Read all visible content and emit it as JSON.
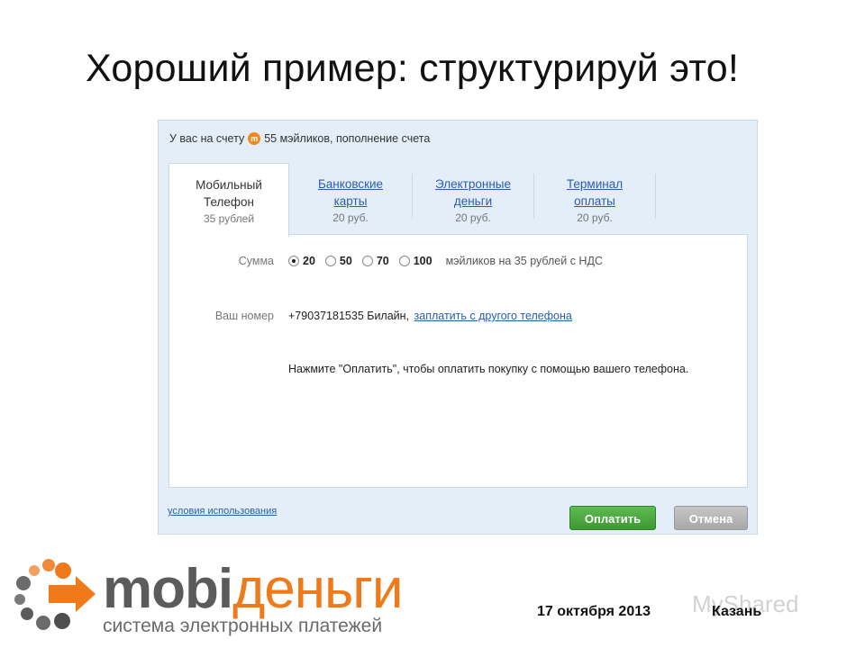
{
  "slide": {
    "title": "Хороший пример: структурируй это!",
    "date": "17 октября 2013",
    "city": "Казань",
    "watermark": "MyShared"
  },
  "widget": {
    "balance_prefix": "У вас на счету",
    "balance_text": "55 мэйликов, пополнение счета",
    "tabs": [
      {
        "label_line1": "Мобильный",
        "label_line2": "Телефон",
        "price": "35 рублей",
        "active": true
      },
      {
        "label_line1": "Банковские",
        "label_line2": "карты",
        "price": "20 руб.",
        "active": false
      },
      {
        "label_line1": "Электронные",
        "label_line2": "деньги",
        "price": "20 руб.",
        "active": false
      },
      {
        "label_line1": "Терминал",
        "label_line2": "оплаты",
        "price": "20 руб.",
        "active": false
      }
    ],
    "sum_label": "Сумма",
    "amounts": [
      "20",
      "50",
      "70",
      "100"
    ],
    "selected_amount": "20",
    "sum_note": "мэйликов на 35 рублей с НДС",
    "phone_label": "Ваш номер",
    "phone_value": "+79037181535 Билайн,",
    "phone_link": "заплатить с другого телефона",
    "instruction": "Нажмите \"Оплатить\", чтобы оплатить покупку с помощью вашего телефона.",
    "terms_link": "условия использования",
    "pay_button": "Оплатить",
    "cancel_button": "Отмена"
  },
  "logo": {
    "name_part1": "mobi",
    "name_part2": "деньги",
    "tagline": "система электронных платежей"
  },
  "colors": {
    "accent": "#f07a1a",
    "link": "#2a5db0",
    "pay": "#4caf45",
    "widget_bg": "#e4eef8"
  }
}
